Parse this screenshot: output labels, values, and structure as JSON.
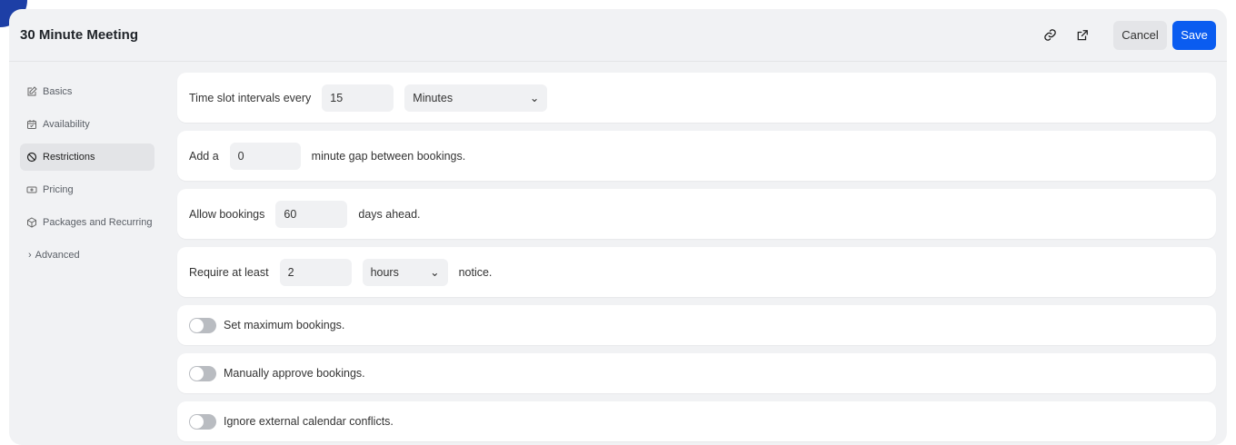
{
  "header": {
    "title": "30 Minute Meeting",
    "cancel": "Cancel",
    "save": "Save"
  },
  "sidebar": {
    "items": [
      {
        "label": "Basics",
        "icon": "edit-icon"
      },
      {
        "label": "Availability",
        "icon": "calendar-icon"
      },
      {
        "label": "Restrictions",
        "icon": "ban-icon",
        "active": true
      },
      {
        "label": "Pricing",
        "icon": "money-icon"
      },
      {
        "label": "Packages and Recurring",
        "icon": "package-icon"
      }
    ],
    "advanced": "Advanced"
  },
  "interval": {
    "label": "Time slot intervals every",
    "value": "15",
    "unit": "Minutes"
  },
  "gap": {
    "pre": "Add a",
    "value": "0",
    "post": "minute gap between bookings."
  },
  "ahead": {
    "pre": "Allow bookings",
    "value": "60",
    "post": "days ahead."
  },
  "notice": {
    "pre": "Require at least",
    "value": "2",
    "unit": "hours",
    "post": "notice."
  },
  "toggles": [
    {
      "label": "Set maximum bookings.",
      "on": false
    },
    {
      "label": "Manually approve bookings.",
      "on": false
    },
    {
      "label": "Ignore external calendar conflicts.",
      "on": false
    }
  ]
}
